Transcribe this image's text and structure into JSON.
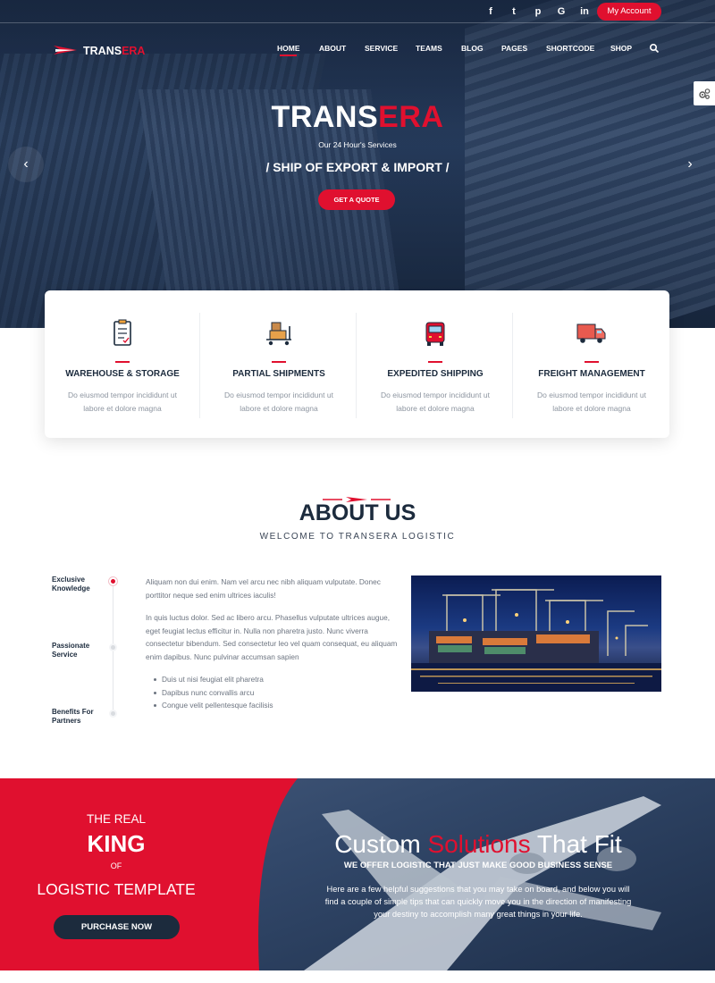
{
  "colors": {
    "accent": "#e0102f",
    "navy": "#1c2b3d"
  },
  "topbar": {
    "social": [
      {
        "icon": "facebook-icon",
        "glyph": "f"
      },
      {
        "icon": "twitter-icon",
        "glyph": "t"
      },
      {
        "icon": "pinterest-icon",
        "glyph": "p"
      },
      {
        "icon": "google-icon",
        "glyph": "G"
      },
      {
        "icon": "linkedin-icon",
        "glyph": "in"
      }
    ],
    "account_label": "My Account"
  },
  "logo": {
    "part1": "TRANS",
    "part2": "ERA"
  },
  "nav": {
    "items": [
      "HOME",
      "ABOUT",
      "SERVICE",
      "TEAMS",
      "BLOG",
      "PAGES",
      "SHORTCODE",
      "SHOP"
    ],
    "active": "HOME"
  },
  "hero": {
    "title_part1": "TRANS",
    "title_part2": "ERA",
    "subtitle": "Our 24 Hour's Services",
    "tagline": "/ SHIP OF EXPORT & IMPORT /",
    "cta": "GET A QUOTE",
    "prev_glyph": "‹",
    "next_glyph": "›"
  },
  "services": [
    {
      "icon": "clipboard-icon",
      "title": "WAREHOUSE & STORAGE",
      "desc": "Do eiusmod tempor incididunt ut labore et dolore magna"
    },
    {
      "icon": "trolley-icon",
      "title": "PARTIAL SHIPMENTS",
      "desc": "Do eiusmod tempor incididunt ut labore et dolore magna"
    },
    {
      "icon": "truck-front-icon",
      "title": "EXPEDITED SHIPPING",
      "desc": "Do eiusmod tempor incididunt ut labore et dolore magna"
    },
    {
      "icon": "delivery-truck-icon",
      "title": "FREIGHT MANAGEMENT",
      "desc": "Do eiusmod tempor incididunt ut labore et dolore magna"
    }
  ],
  "about": {
    "title": "ABOUT US",
    "subtitle": "WELCOME TO TRANSERA LOGISTIC",
    "timeline": [
      {
        "line1": "Exclusive",
        "line2": "Knowledge",
        "active": true
      },
      {
        "line1": "Passionate",
        "line2": "Service",
        "active": false
      },
      {
        "line1": "Benefits For",
        "line2": "Partners",
        "active": false
      }
    ],
    "para1": "Aliquam non dui enim. Nam vel arcu nec nibh aliquam vulputate. Donec porttitor neque sed enim ultrices iaculis!",
    "para2": "In quis luctus dolor. Sed ac libero arcu. Phasellus vulputate ultrices augue, eget feugiat lectus efficitur in. Nulla non pharetra justo. Nunc viverra consectetur bibendum. Sed consectetur leo vel quam consequat, eu aliquam enim dapibus. Nunc pulvinar accumsan sapien",
    "bullets": [
      "Duis ut nisi feugiat elit pharetra",
      "Dapibus nunc convallis arcu",
      "Congue velit pellentesque facilisis"
    ]
  },
  "banner": {
    "line1": "THE REAL",
    "line2": "KING",
    "line3": "OF",
    "line4": "LOGISTIC TEMPLATE",
    "cta": "PURCHASE NOW",
    "head_part1": "Custom ",
    "head_part2": "Solutions",
    "head_part3": " That Fit",
    "tagline": "WE OFFER LOGISTIC THAT JUST MAKE GOOD BUSINESS SENSE",
    "paragraph": "Here are a few helpful suggestions that you may take on board, and below you will find a couple of simple tips that can quickly move you in the direction of manifesting your destiny to accomplish many great things in your life."
  }
}
